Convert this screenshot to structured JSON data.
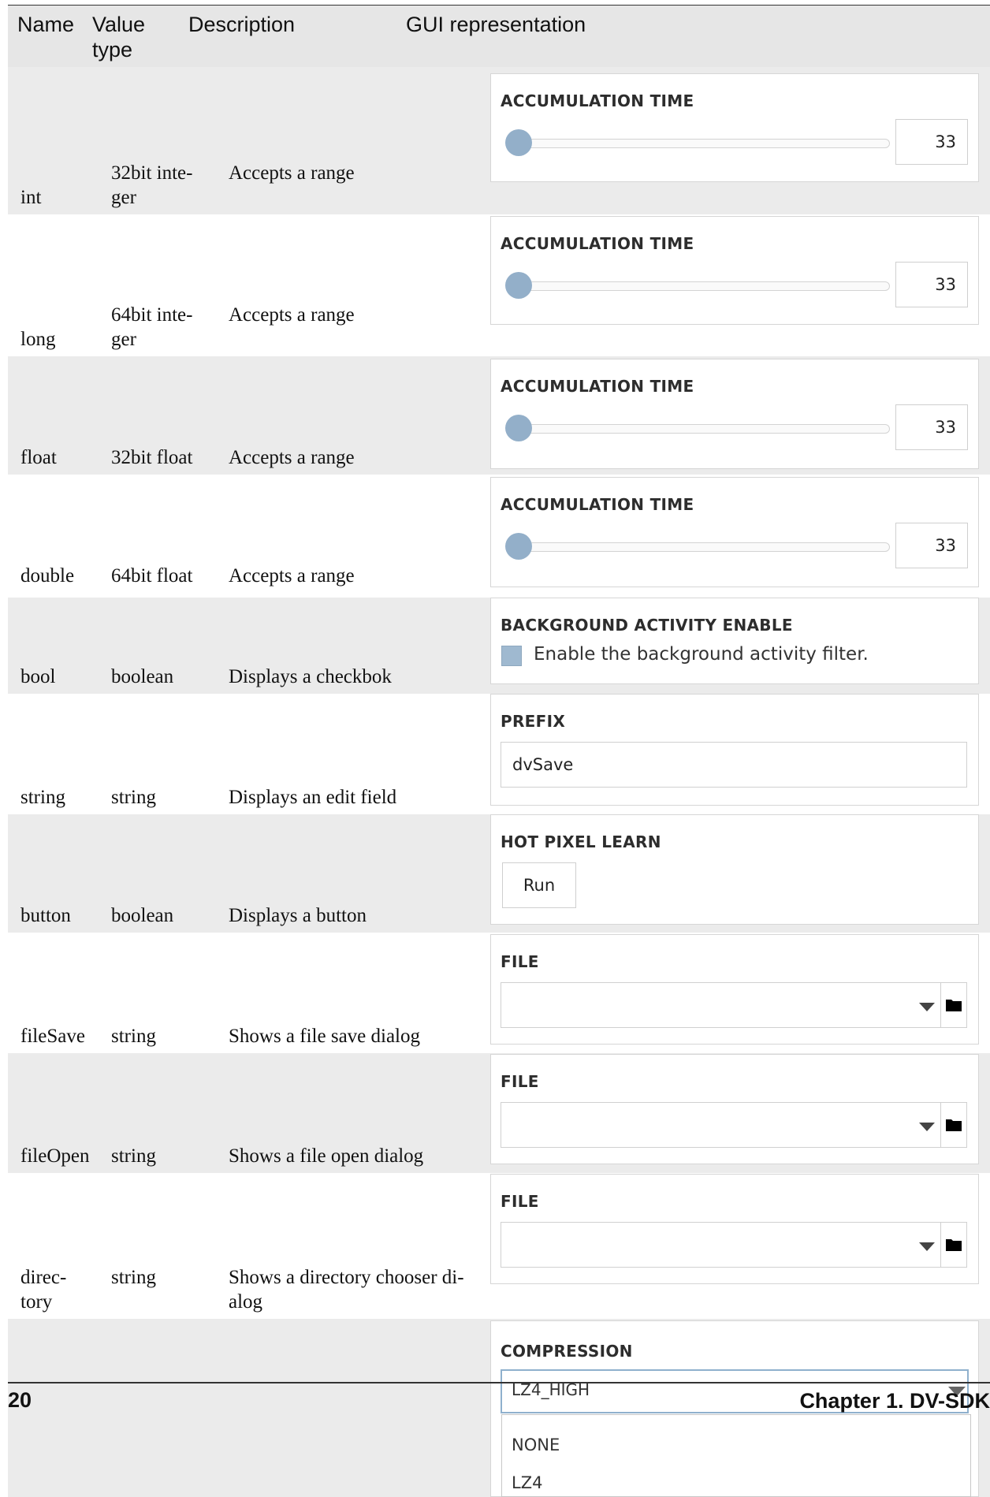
{
  "table": {
    "headers": {
      "name": "Name",
      "value_type_l1": "Value",
      "value_type_l2": "type",
      "description": "Description",
      "gui": "GUI representation"
    },
    "rows": [
      {
        "name": "int",
        "type_l1": "32bit inte-",
        "type_l2": "ger",
        "description": "Accepts a range"
      },
      {
        "name": "long",
        "type_l1": "64bit inte-",
        "type_l2": "ger",
        "description": "Accepts a range"
      },
      {
        "name": "float",
        "type": "32bit float",
        "description": "Accepts a range"
      },
      {
        "name": "double",
        "type": "64bit float",
        "description": "Accepts a range"
      },
      {
        "name": "bool",
        "type": "boolean",
        "description": "Displays a checkbok"
      },
      {
        "name": "string",
        "type": "string",
        "description": "Displays an edit field"
      },
      {
        "name": "button",
        "type": "boolean",
        "description": "Displays a button"
      },
      {
        "name": "fileSave",
        "type": "string",
        "description": "Shows a file save dialog"
      },
      {
        "name": "fileOpen",
        "type": "string",
        "description": "Shows a file open dialog"
      },
      {
        "name_l1": "direc-",
        "name_l2": "tory",
        "type": "string",
        "desc_l1": "Shows a directory chooser di-",
        "desc_l2": "alog"
      }
    ]
  },
  "gui": {
    "slider_label": "ACCUMULATION TIME",
    "slider_value": "33",
    "bool_label": "BACKGROUND ACTIVITY ENABLE",
    "bool_text": "Enable the background activity filter.",
    "string_label": "PREFIX",
    "string_value": "dvSave",
    "button_label": "HOT PIXEL LEARN",
    "button_text": "Run",
    "file_label": "FILE",
    "compression_label": "COMPRESSION",
    "compression_value": "LZ4_HIGH",
    "options": [
      "NONE",
      "LZ4"
    ]
  },
  "footer": {
    "page_number": "20",
    "chapter": "Chapter 1.  DV-SDK"
  }
}
